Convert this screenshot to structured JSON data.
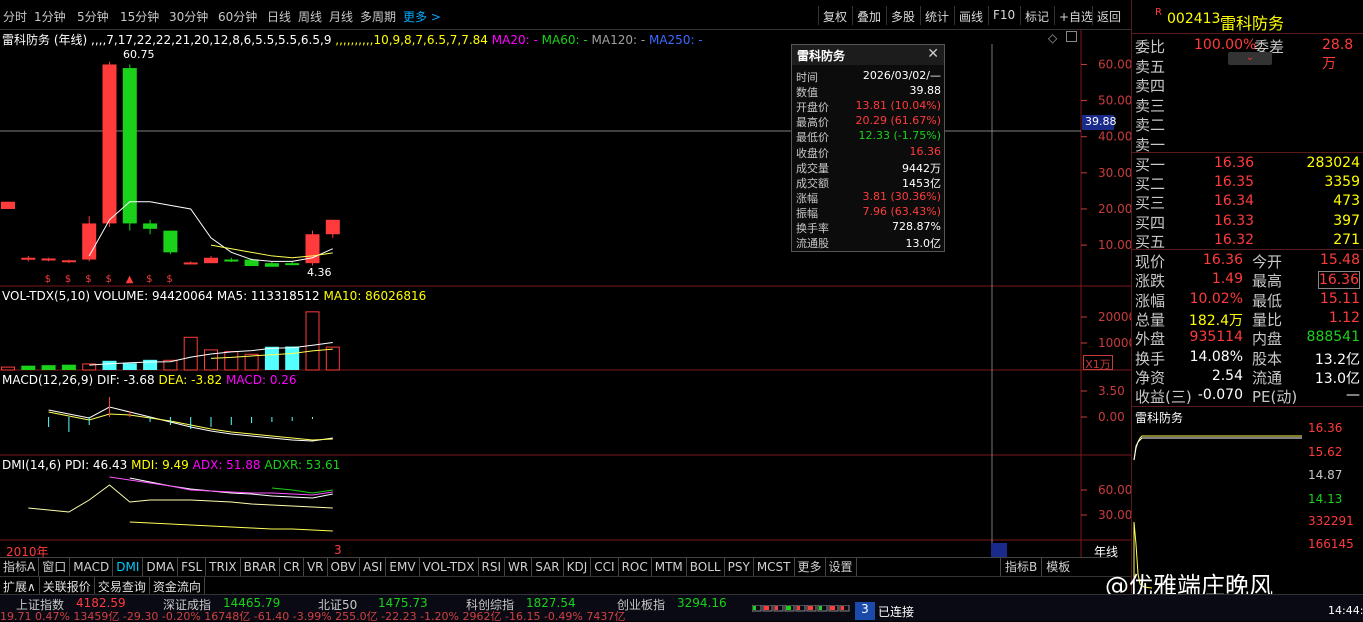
{
  "periods": [
    "分时",
    "1分钟",
    "5分钟",
    "15分钟",
    "30分钟",
    "60分钟",
    "日线",
    "周线",
    "月线",
    "多周期",
    "更多 >"
  ],
  "toolbar": [
    "复权",
    "叠加",
    "多股",
    "统计",
    "画线",
    "F10",
    "标记",
    "+自选",
    "返回"
  ],
  "stock": {
    "code": "002413",
    "name": "雷科防务",
    "r": "R"
  },
  "main": {
    "title": "雷科防务 (年线)",
    "ma5": [
      null,
      null,
      null,
      null,
      7,
      17,
      22,
      22,
      21,
      20,
      12,
      8,
      6,
      5.5,
      5.5,
      6.5,
      9
    ],
    "ma10": [
      null,
      null,
      null,
      null,
      null,
      null,
      null,
      null,
      null,
      null,
      10,
      9,
      8,
      7,
      6.5,
      7,
      7.84
    ],
    "ma20": "MA20: -",
    "ma60": "MA60: -",
    "ma120": "MA120: -",
    "ma250": "MA250: -",
    "high": "60.75",
    "low": "4.36",
    "crosshair": "39.88",
    "yaxis": [
      "60.00",
      "50.00",
      "40.00",
      "30.00",
      "20.00",
      "10.00"
    ],
    "candles": [
      {
        "o": 20,
        "c": 22,
        "h": 22,
        "l": 20
      },
      {
        "o": 6,
        "c": 6.5,
        "h": 7,
        "l": 5.5
      },
      {
        "o": 6,
        "c": 6.3,
        "h": 6.5,
        "l": 5.5
      },
      {
        "o": 5.5,
        "c": 5.8,
        "h": 6,
        "l": 5
      },
      {
        "o": 6,
        "c": 16,
        "h": 18,
        "l": 5.5
      },
      {
        "o": 16,
        "c": 60,
        "h": 60.75,
        "l": 15
      },
      {
        "o": 59,
        "c": 16,
        "h": 60,
        "l": 14
      },
      {
        "o": 16,
        "c": 14.5,
        "h": 17,
        "l": 13
      },
      {
        "o": 14,
        "c": 8,
        "h": 14,
        "l": 7.5
      },
      {
        "o": 5,
        "c": 5.2,
        "h": 5.5,
        "l": 4.8
      },
      {
        "o": 5,
        "c": 6.5,
        "h": 7,
        "l": 5
      },
      {
        "o": 6,
        "c": 5.5,
        "h": 6.5,
        "l": 5.3
      },
      {
        "o": 6,
        "c": 4.2,
        "h": 6.3,
        "l": 4.36
      },
      {
        "o": 5,
        "c": 4,
        "h": 5.4,
        "l": 4.4
      },
      {
        "o": 5,
        "c": 4.5,
        "h": 5.5,
        "l": 4.4
      },
      {
        "o": 5,
        "c": 13,
        "h": 14,
        "l": 4.36
      },
      {
        "o": 13,
        "c": 17,
        "h": 17,
        "l": 12
      }
    ]
  },
  "vol": {
    "title": "VOL-TDX(5,10)",
    "volume": "VOLUME: 94420064",
    "ma5": "MA5: 113318512",
    "ma10": "MA10: 86026816",
    "yaxis": [
      "20000",
      "10000"
    ],
    "unit": "X1万",
    "bars": [
      {
        "v": 1200,
        "c": "r"
      },
      {
        "v": 1800,
        "c": "g"
      },
      {
        "v": 2000,
        "c": "g"
      },
      {
        "v": 2200,
        "c": "g"
      },
      {
        "v": 2500,
        "c": "r"
      },
      {
        "v": 3800,
        "c": "c"
      },
      {
        "v": 2800,
        "c": "c"
      },
      {
        "v": 4200,
        "c": "c"
      },
      {
        "v": 4000,
        "c": "r"
      },
      {
        "v": 13500,
        "c": "r"
      },
      {
        "v": 8300,
        "c": "r"
      },
      {
        "v": 7600,
        "c": "r"
      },
      {
        "v": 6500,
        "c": "r"
      },
      {
        "v": 9600,
        "c": "c"
      },
      {
        "v": 9700,
        "c": "c"
      },
      {
        "v": 24000,
        "c": "r"
      },
      {
        "v": 9442,
        "c": "r"
      }
    ]
  },
  "macd": {
    "title": "MACD(12,26,9)",
    "dif": "DIF: -3.68",
    "dea": "DEA: -3.82",
    "mv": "MACD: 0.26",
    "yaxis": [
      "3.50",
      "0.00"
    ]
  },
  "dmi": {
    "title": "DMI(14,6)",
    "pdi": "PDI: 46.43",
    "mdi": "MDI: 9.49",
    "adx": "ADX: 51.88",
    "adxr": "ADXR: 53.61",
    "yaxis": [
      "60.00",
      "30.00"
    ]
  },
  "xaxis": {
    "left": "2010年",
    "right": "3",
    "period": "年线"
  },
  "popup": {
    "title": "雷科防务",
    "rows": [
      [
        "时间",
        "2026/03/02/—",
        "w"
      ],
      [
        "数值",
        "39.88",
        "w"
      ],
      [
        "开盘价",
        "13.81 (10.04%)",
        "r"
      ],
      [
        "最高价",
        "20.29 (61.67%)",
        "r"
      ],
      [
        "最低价",
        "12.33 (-1.75%)",
        "g"
      ],
      [
        "收盘价",
        "16.36",
        "r"
      ],
      [
        "成交量",
        "9442万",
        "w"
      ],
      [
        "成交额",
        "1453亿",
        "w"
      ],
      [
        "涨幅",
        "3.81 (30.36%)",
        "r"
      ],
      [
        "振幅",
        "7.96 (63.43%)",
        "r"
      ],
      [
        "换手率",
        "728.87%",
        "w"
      ],
      [
        "流通股",
        "13.0亿",
        "w"
      ]
    ]
  },
  "order": {
    "webi": "委比",
    "webi_v": "100.00%",
    "wecha": "委差",
    "wecha_v": "28.8万",
    "sells": [
      "卖五",
      "卖四",
      "卖三",
      "卖二",
      "卖一"
    ],
    "buys": [
      [
        "买一",
        "16.36",
        "283024"
      ],
      [
        "买二",
        "16.35",
        "3359"
      ],
      [
        "买三",
        "16.34",
        "473"
      ],
      [
        "买四",
        "16.33",
        "397"
      ],
      [
        "买五",
        "16.32",
        "271"
      ]
    ]
  },
  "quote": [
    [
      "现价",
      "16.36",
      "今开",
      "15.48"
    ],
    [
      "涨跌",
      "1.49",
      "最高",
      "16.36"
    ],
    [
      "涨幅",
      "10.02%",
      "最低",
      "15.11"
    ],
    [
      "总量",
      "182.4万",
      "量比",
      "1.12"
    ],
    [
      "外盘",
      "935114",
      "内盘",
      "888541"
    ],
    [
      "换手",
      "14.08%",
      "股本",
      "13.2亿"
    ],
    [
      "净资",
      "2.54",
      "流通",
      "13.0亿"
    ],
    [
      "收益(三)",
      "-0.070",
      "PE(动)",
      "—"
    ]
  ],
  "mini": {
    "title": "雷科防务",
    "prices": [
      "16.36",
      "15.62",
      "14.87",
      "14.13"
    ],
    "vols": [
      "332291",
      "166145"
    ]
  },
  "tabs": [
    "指标A",
    "窗口",
    "MACD",
    "DMI",
    "DMA",
    "FSL",
    "TRIX",
    "BRAR",
    "CR",
    "VR",
    "OBV",
    "ASI",
    "EMV",
    "VOL-TDX",
    "RSI",
    "WR",
    "SAR",
    "KDJ",
    "CCI",
    "ROC",
    "MTM",
    "BOLL",
    "PSY",
    "MCST",
    "更多",
    "设置"
  ],
  "tabs_right": [
    "指标B",
    "模板"
  ],
  "tabs2": [
    "扩展∧",
    "关联报价",
    "交易查询",
    "资金流向"
  ],
  "watermark": "@优雅端庄晚风",
  "status": {
    "row1": [
      [
        "上证指数",
        "4182.59"
      ],
      [
        "深证成指",
        "14465.79"
      ],
      [
        "北证50",
        "1475.73"
      ],
      [
        "科创综指",
        "1827.54"
      ],
      [
        "创业板指",
        "3294.16"
      ]
    ],
    "row2": "19.71 0.47% 13459亿 -29.30 -0.20% 16748亿 -61.40 -3.99% 255.0亿 -22.23 -1.20% 2962亿 -16.15 -0.49% 7437亿",
    "conn_num": "3",
    "conn": "已连接",
    "time": "14:44:53"
  }
}
